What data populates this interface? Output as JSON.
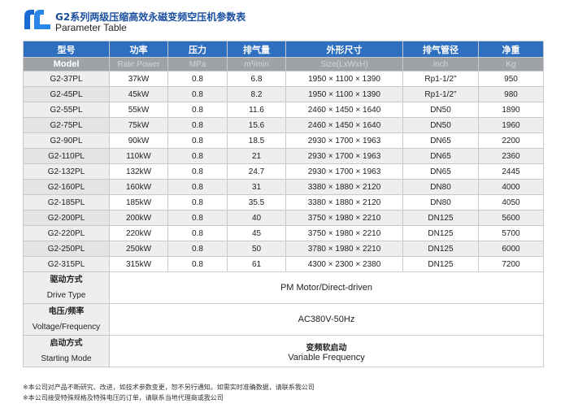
{
  "header": {
    "title_cn": "G2系列两级压缩高效永磁变频空压机参数表",
    "title_en": "Parameter Table",
    "brand_color": "#1a4fa0"
  },
  "table": {
    "columns_cn": [
      "型号",
      "功率",
      "压力",
      "排气量",
      "外形尺寸",
      "排气管径",
      "净重"
    ],
    "columns_en": [
      "Model",
      "Rate Power",
      "MPa",
      "m³/min",
      "Size(LxWxH)",
      "inch",
      "Kg"
    ],
    "rows": [
      [
        "G2-37PL",
        "37kW",
        "0.8",
        "6.8",
        "1950 × 1100 × 1390",
        "Rp1-1/2\"",
        "950"
      ],
      [
        "G2-45PL",
        "45kW",
        "0.8",
        "8.2",
        "1950 × 1100 × 1390",
        "Rp1-1/2\"",
        "980"
      ],
      [
        "G2-55PL",
        "55kW",
        "0.8",
        "11.6",
        "2460 × 1450 × 1640",
        "DN50",
        "1890"
      ],
      [
        "G2-75PL",
        "75kW",
        "0.8",
        "15.6",
        "2460 × 1450 × 1640",
        "DN50",
        "1960"
      ],
      [
        "G2-90PL",
        "90kW",
        "0.8",
        "18.5",
        "2930 × 1700 × 1963",
        "DN65",
        "2200"
      ],
      [
        "G2-110PL",
        "110kW",
        "0.8",
        "21",
        "2930 × 1700 × 1963",
        "DN65",
        "2360"
      ],
      [
        "G2-132PL",
        "132kW",
        "0.8",
        "24.7",
        "2930 × 1700 × 1963",
        "DN65",
        "2445"
      ],
      [
        "G2-160PL",
        "160kW",
        "0.8",
        "31",
        "3380 × 1880 × 2120",
        "DN80",
        "4000"
      ],
      [
        "G2-185PL",
        "185kW",
        "0.8",
        "35.5",
        "3380 × 1880 × 2120",
        "DN80",
        "4050"
      ],
      [
        "G2-200PL",
        "200kW",
        "0.8",
        "40",
        "3750 × 1980 × 2210",
        "DN125",
        "5600"
      ],
      [
        "G2-220PL",
        "220kW",
        "0.8",
        "45",
        "3750 × 1980 × 2210",
        "DN125",
        "5700"
      ],
      [
        "G2-250PL",
        "250kW",
        "0.8",
        "50",
        "3780 × 1980 × 2210",
        "DN125",
        "6000"
      ],
      [
        "G2-315PL",
        "315kW",
        "0.8",
        "61",
        "4300 × 2300 × 2380",
        "DN125",
        "7200"
      ]
    ],
    "specs": [
      {
        "label_cn": "驱动方式",
        "label_en": "Drive Type",
        "value_cn": "",
        "value_en": "PM Motor/Direct-driven"
      },
      {
        "label_cn": "电压/频率",
        "label_en": "Voltage/Frequency",
        "value_cn": "",
        "value_en": "AC380V-50Hz"
      },
      {
        "label_cn": "启动方式",
        "label_en": "Starting Mode",
        "value_cn": "变频软启动",
        "value_en": "Variable Frequency"
      }
    ],
    "header_color": "#2f6fbf",
    "subheader_color": "#9fa3a7"
  },
  "notes": [
    "※本公司对产品不断研究、改进，如技术参数变更，恕不另行通知。如需实时准确数据，请联系我公司",
    "※本公司接受特殊规格及特殊电压的订单，请联系当地代理商或我公司"
  ]
}
